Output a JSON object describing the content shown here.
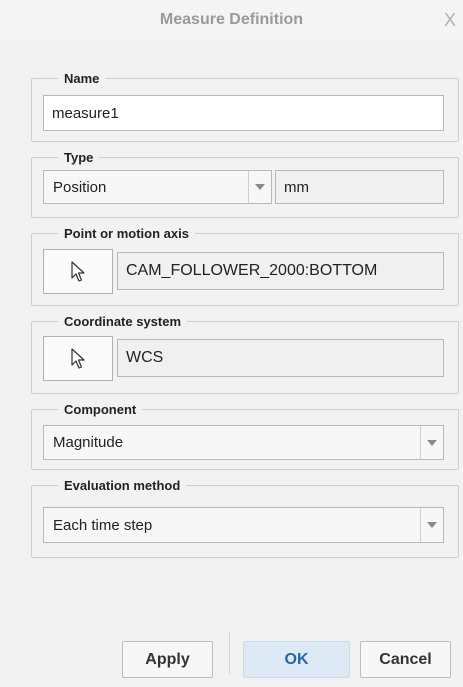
{
  "window": {
    "title": "Measure Definition",
    "close_glyph": "X"
  },
  "name_group": {
    "legend": "Name",
    "value": "measure1"
  },
  "type_group": {
    "legend": "Type",
    "selected": "Position",
    "unit": "mm"
  },
  "point_group": {
    "legend": "Point or motion axis",
    "value": "CAM_FOLLOWER_2000:BOTTOM",
    "select_icon": "cursor-arrow-icon"
  },
  "coord_group": {
    "legend": "Coordinate system",
    "value": "WCS",
    "select_icon": "cursor-arrow-icon"
  },
  "component_group": {
    "legend": "Component",
    "selected": "Magnitude"
  },
  "eval_group": {
    "legend": "Evaluation method",
    "selected": "Each time step"
  },
  "buttons": {
    "apply": "Apply",
    "ok": "OK",
    "cancel": "Cancel"
  },
  "colors": {
    "accent_text": "#2a63a8",
    "primary_bg": "#ddeaf5"
  }
}
